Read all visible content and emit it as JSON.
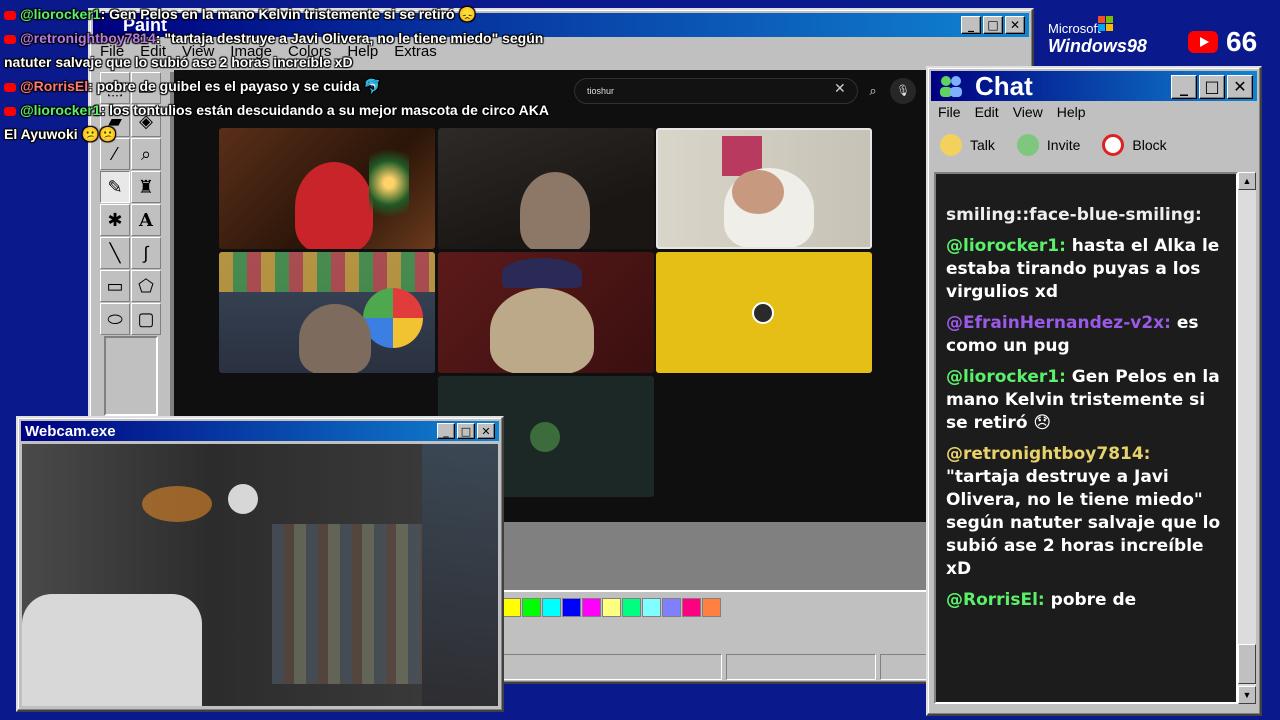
{
  "paint": {
    "title": "Paint",
    "menu": [
      "File",
      "Edit",
      "View",
      "Image",
      "Colors",
      "Help",
      "Extras"
    ],
    "palette": [
      "#ffff00",
      "#00ff00",
      "#00ffff",
      "#0000ff",
      "#ff00ff",
      "#ffff80",
      "#00ff80",
      "#80ffff",
      "#8080ff",
      "#ff0080",
      "#ff8040"
    ]
  },
  "browser": {
    "search_query": "tioshur"
  },
  "chat_window": {
    "title": "Chat",
    "menu": [
      "File",
      "Edit",
      "View",
      "Help"
    ],
    "toolbar": [
      "Talk",
      "Invite",
      "Block"
    ],
    "messages": [
      {
        "user": "",
        "text": "smiling::face-blue-smiling:"
      },
      {
        "user": "@liorocker1:",
        "text": " hasta el Alka le estaba tirando puyas a los virgulios xd",
        "color": "#5bf06a"
      },
      {
        "user": "@EfrainHernandez-v2x:",
        "text": " es como un pug",
        "color": "#9b59e8"
      },
      {
        "user": "@liorocker1:",
        "text": " Gen Pelos en la mano Kelvin tristemente si se retiró 😞",
        "color": "#5bf06a"
      },
      {
        "user": "@retronightboy7814:",
        "text": " \"tartaja destruye a Javi Olivera, no le tiene miedo\" según natuter salvaje que lo subió ase 2 horas increíble xD",
        "color": "#e8d26a"
      },
      {
        "user": "@RorrisEl:",
        "text": " pobre de",
        "color": "#5bf06a"
      }
    ]
  },
  "webcam": {
    "title": "Webcam.exe"
  },
  "overlay_chat": [
    {
      "user": "@liorocker1",
      "text": ": Gen Pelos en la mano Kelvin tristemente si se retiró 😞",
      "color": "green"
    },
    {
      "user": "@retronightboy7814",
      "text": ": \"tartaja destruye a Javi Olivera, no le tiene miedo\" según",
      "color": "purple"
    },
    {
      "user": "",
      "text": "natuter salvaje que lo subió ase 2 horas increíble xD",
      "color": ""
    },
    {
      "user": "@RorrisEl",
      "text": ": pobre de guibel es el payaso y se cuida 🐬",
      "color": "red"
    },
    {
      "user": "@liorocker1",
      "text": ": los tontulios están descuidando a su mejor mascota de circo AKA",
      "color": "green"
    },
    {
      "user": "",
      "text": "El Ayuwoki 😕😕",
      "color": ""
    }
  ],
  "branding": {
    "ms_top": "Microsoft",
    "ms_bottom": "Windows98",
    "yt_count": "66"
  }
}
